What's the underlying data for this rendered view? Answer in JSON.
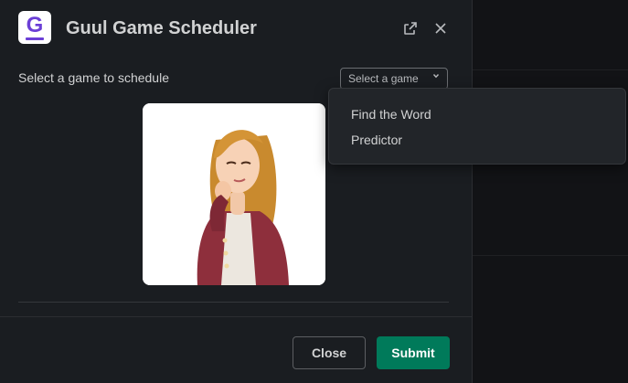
{
  "app": {
    "logo_letter": "G",
    "title": "Guul Game Scheduler"
  },
  "header_icons": [
    "external-link-icon",
    "close-icon"
  ],
  "form": {
    "label": "Select a game to schedule",
    "select_placeholder": "Select a game"
  },
  "dropdown": {
    "options": [
      "Find the Word",
      "Predictor"
    ]
  },
  "footer": {
    "close_label": "Close",
    "submit_label": "Submit"
  },
  "colors": {
    "modal_bg": "#1a1d21",
    "submit_bg": "#007a5a",
    "brand": "#6b3fd6"
  }
}
